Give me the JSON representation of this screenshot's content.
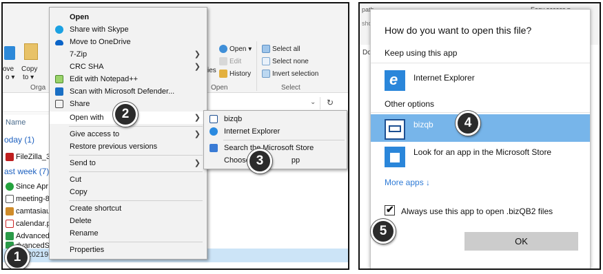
{
  "explorer": {
    "ribbon": {
      "move_label": "ove",
      "move_label2": "o ▾",
      "copy_label": "Copy",
      "copy_label2": "to ▾",
      "organize_group": "Orga",
      "ies_fragment": "ies",
      "open_label": "Open ▾",
      "edit_label": "Edit",
      "history_label": "History",
      "open_group": "Open",
      "select_all": "Select all",
      "select_none": "Select none",
      "invert_selection": "Invert selection",
      "select_group": "Select"
    },
    "column_name": "Name",
    "group_today": "oday (1)",
    "group_last_week": "ast week (7)",
    "files": [
      "FileZilla_3.5",
      "Since Apr (",
      "meeting-8",
      "camtasiaup",
      "calendar.p",
      "AdvancedS",
      "dvancedS"
    ],
    "selected_file": "-20219-10-20PM.bizQB2"
  },
  "context_menu": {
    "items": [
      {
        "label": "Open",
        "bold": true
      },
      {
        "label": "Share with Skype"
      },
      {
        "label": "Move to OneDrive"
      },
      {
        "label": "7-Zip",
        "arrow": true
      },
      {
        "label": "CRC SHA",
        "arrow": true
      },
      {
        "label": "Edit with Notepad++"
      },
      {
        "label": "Scan with Microsoft Defender..."
      },
      {
        "label": "Share"
      },
      {
        "label": "Open with",
        "arrow": true
      },
      {
        "label": "Give access to",
        "arrow": true
      },
      {
        "label": "Restore previous versions"
      },
      {
        "label": "Send to",
        "arrow": true
      },
      {
        "label": "Cut"
      },
      {
        "label": "Copy"
      },
      {
        "label": "Create shortcut"
      },
      {
        "label": "Delete"
      },
      {
        "label": "Rename"
      },
      {
        "label": "Properties"
      }
    ]
  },
  "open_with_submenu": {
    "items": [
      "bizqb",
      "Internet Explorer",
      "Search the Microsoft Store",
      "Choose ",
      "pp"
    ]
  },
  "dialog": {
    "top_fragment_path": "path",
    "top_fragment_sho": "sho",
    "top_fragment_do": "Do",
    "top_easy_access": "Easy access ▾",
    "title": "How do you want to open this file?",
    "keep_using": "Keep using this app",
    "current_app": "Internet Explorer",
    "other_options": "Other options",
    "option_bizqb": "bizqb",
    "option_store": "Look for an app in the Microsoft Store",
    "more_apps": "More apps  ↓",
    "always_use": "Always use this app to open .bizQB2 files",
    "ok": "OK"
  },
  "steps": [
    "1",
    "2",
    "3",
    "4",
    "5"
  ],
  "colors": {
    "highlight_blue": "#77b5ea",
    "link_blue": "#2f7bd6",
    "group_blue": "#1b5fbf",
    "badge": "#2b2b2b"
  }
}
